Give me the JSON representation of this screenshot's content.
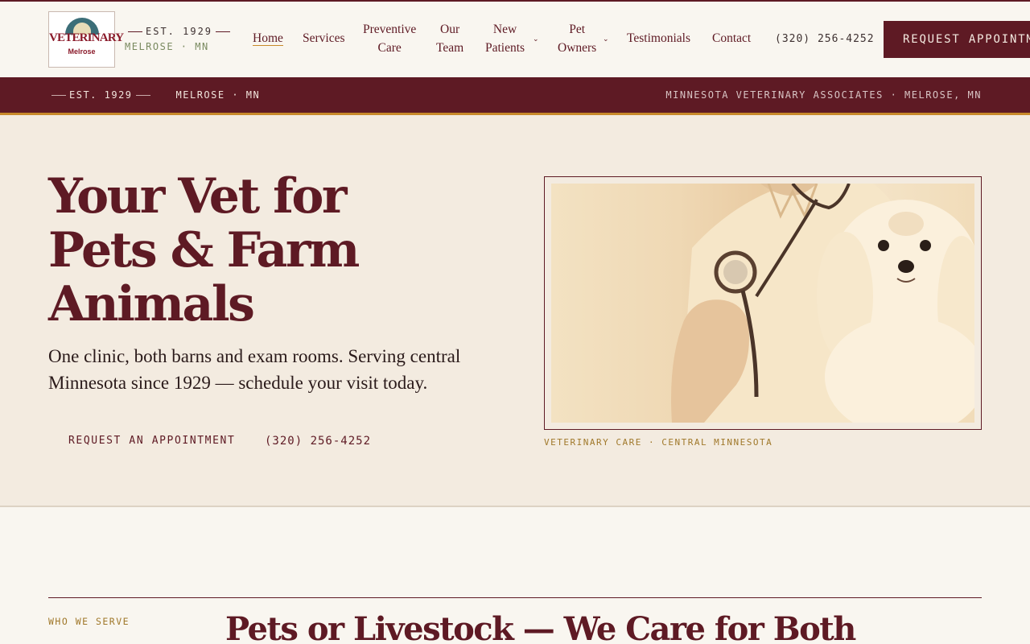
{
  "brand": {
    "logo_word": "VETERINARY",
    "logo_sub": "Melrose",
    "est": "EST. 1929",
    "location": "MELROSE · MN"
  },
  "nav": {
    "home": "Home",
    "services": "Services",
    "preventive_1": "Preventive",
    "preventive_2": "Care",
    "team_1": "Our",
    "team_2": "Team",
    "new_1": "New",
    "new_2": "Patients",
    "owners_1": "Pet",
    "owners_2": "Owners",
    "testimonials": "Testimonials",
    "contact": "Contact",
    "dropdown_glyph": "⌄"
  },
  "header": {
    "phone": "(320) 256-4252",
    "cta": "REQUEST APPOINTMENT"
  },
  "banner": {
    "est": "EST. 1929",
    "location": "MELROSE · MN",
    "right": "MINNESOTA VETERINARY ASSOCIATES · MELROSE, MN"
  },
  "hero": {
    "title_1": "Your Vet for",
    "title_2": "Pets & Farm",
    "title_3": "Animals",
    "lead": "One clinic, both barns and exam rooms. Serving central Minnesota since 1929 — schedule your visit today.",
    "cta_primary": "REQUEST AN APPOINTMENT",
    "cta_phone": "(320) 256-4252",
    "caption": "VETERINARY CARE · CENTRAL MINNESOTA"
  },
  "section": {
    "eyebrow": "WHO WE SERVE",
    "title": "Pets or Livestock — We Care for Both"
  },
  "colors": {
    "brand": "#5e1a24",
    "accent": "#c8892a",
    "background": "#f9f6f0",
    "hero_bg": "#f3ebe0"
  }
}
